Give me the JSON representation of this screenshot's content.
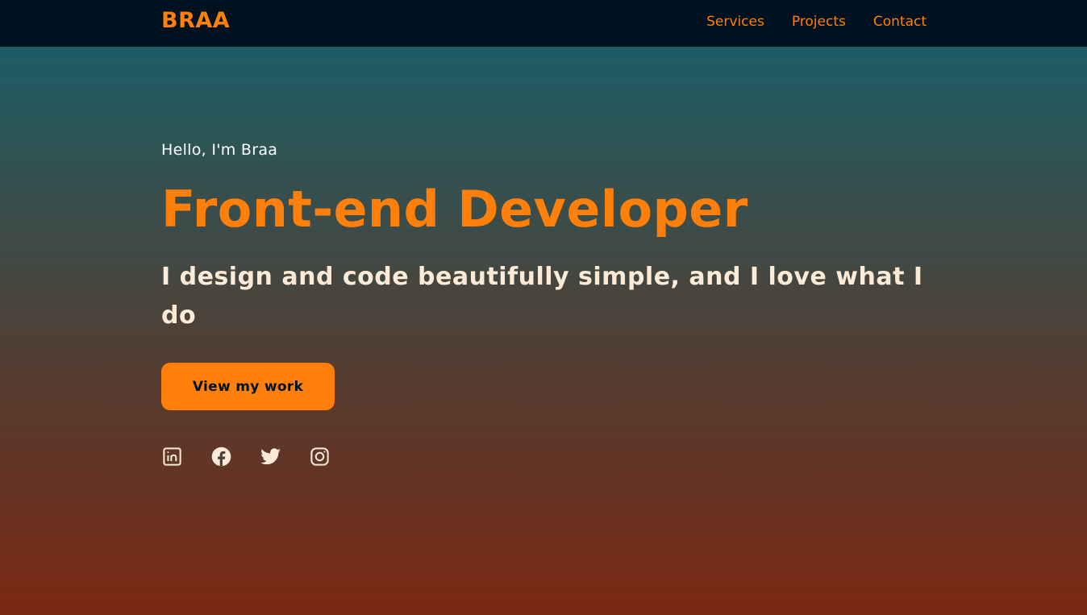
{
  "brand": {
    "logo": "BRAA",
    "accent": "#fe7f0a",
    "dark": "#001220"
  },
  "nav": {
    "items": [
      {
        "label": "Services"
      },
      {
        "label": "Projects"
      },
      {
        "label": "Contact"
      }
    ]
  },
  "hero": {
    "greeting": "Hello, I'm Braa",
    "title": "Front-end Developer",
    "tagline": "I design and code beautifully simple, and I love what I do",
    "cta_label": "View my work"
  },
  "socials": [
    {
      "icon": "linkedin-icon"
    },
    {
      "icon": "facebook-icon"
    },
    {
      "icon": "twitter-icon"
    },
    {
      "icon": "instagram-icon"
    }
  ]
}
